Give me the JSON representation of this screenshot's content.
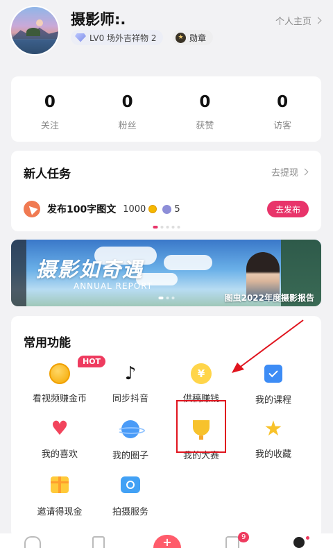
{
  "profile": {
    "username": "摄影师:.",
    "profile_link": "个人主页",
    "level": "LV0 场外吉祥物 2",
    "badge": "勋章"
  },
  "stats": [
    {
      "value": "0",
      "label": "关注"
    },
    {
      "value": "0",
      "label": "粉丝"
    },
    {
      "value": "0",
      "label": "获赞"
    },
    {
      "value": "0",
      "label": "访客"
    }
  ],
  "tasks": {
    "title": "新人任务",
    "more_label": "去提现",
    "task_text": "发布100字图文",
    "coin_reward": "1000",
    "gem_reward": "5",
    "button_label": "去发布"
  },
  "banner": {
    "title": "摄影如奇遇",
    "subtitle": "ANNUAL REPORT",
    "caption": "图虫2022年度摄影报告"
  },
  "functions": {
    "title": "常用功能",
    "hot_badge": "HOT",
    "items": [
      {
        "label": "看视频赚金币",
        "icon": "coin-icon"
      },
      {
        "label": "同步抖音",
        "icon": "tiktok-icon"
      },
      {
        "label": "供稿赚钱",
        "icon": "yuan-coin-icon"
      },
      {
        "label": "我的课程",
        "icon": "calendar-check-icon"
      },
      {
        "label": "我的喜欢",
        "icon": "heart-icon"
      },
      {
        "label": "我的圈子",
        "icon": "planet-icon"
      },
      {
        "label": "我的大赛",
        "icon": "trophy-icon"
      },
      {
        "label": "我的收藏",
        "icon": "star-icon"
      },
      {
        "label": "邀请得现金",
        "icon": "gift-icon"
      },
      {
        "label": "拍摄服务",
        "icon": "camera-icon"
      }
    ]
  },
  "bottom_nav": {
    "message_badge": "9",
    "plus": "+"
  },
  "colors": {
    "accent": "#e8346a",
    "highlight": "#e0141e"
  }
}
